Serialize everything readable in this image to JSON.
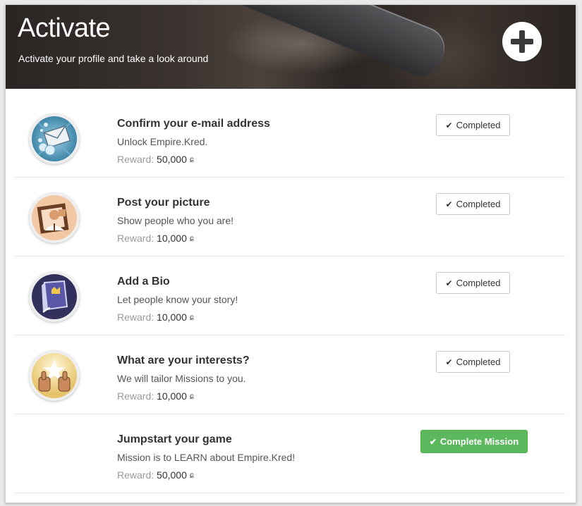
{
  "header": {
    "title": "Activate",
    "subtitle": "Activate your profile and take a look around",
    "add_icon": "plus-icon"
  },
  "missions": [
    {
      "title": "Confirm your e-mail address",
      "description": "Unlock Empire.Kred.",
      "reward_label": "Reward:",
      "reward_amount": "50,000",
      "button": "Completed",
      "badge_icon": "envelope-icon"
    },
    {
      "title": "Post your picture",
      "description": "Show people who you are!",
      "reward_label": "Reward:",
      "reward_amount": "10,000",
      "button": "Completed",
      "badge_icon": "portrait-icon"
    },
    {
      "title": "Add a Bio",
      "description": "Let people know your story!",
      "reward_label": "Reward:",
      "reward_amount": "10,000",
      "button": "Completed",
      "badge_icon": "book-icon"
    },
    {
      "title": "What are your interests?",
      "description": "We will tailor Missions to you.",
      "reward_label": "Reward:",
      "reward_amount": "10,000",
      "button": "Completed",
      "badge_icon": "thumbs-up-icon"
    },
    {
      "title": "Jumpstart your game",
      "description": "Mission is to LEARN about Empire.Kred!",
      "reward_label": "Reward:",
      "reward_amount": "50,000",
      "button": "Complete Mission",
      "badge_icon": ""
    }
  ],
  "colors": {
    "accent_green": "#5cb85c",
    "text_dark": "#333333",
    "text_muted": "#999999"
  }
}
